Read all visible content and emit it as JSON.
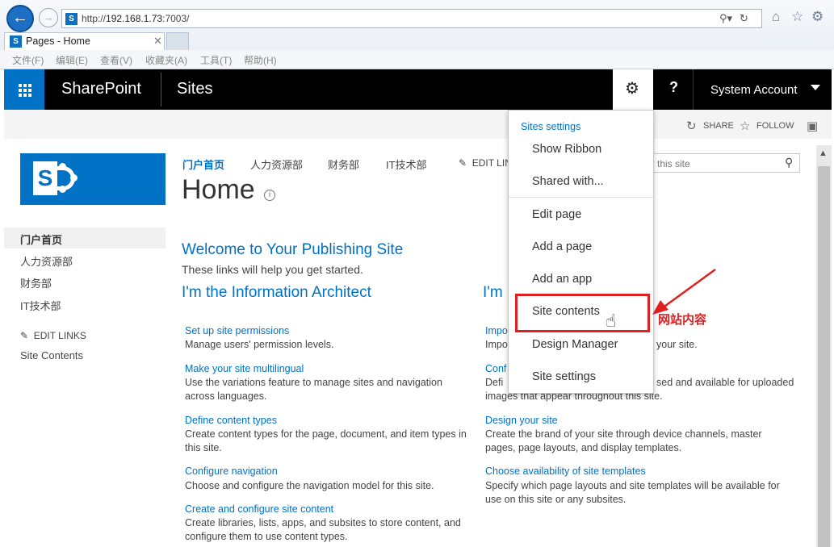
{
  "browser": {
    "address_url": "http://",
    "address_host": "192.168.1.73",
    "address_port": ":7003/",
    "tab_title": "Pages - Home",
    "menus": [
      "文件(F)",
      "编辑(E)",
      "查看(V)",
      "收藏夹(A)",
      "工具(T)",
      "帮助(H)"
    ]
  },
  "suite": {
    "brand": "SharePoint",
    "sites": "Sites",
    "help": "?",
    "account": "System Account",
    "accent": "#0072c6"
  },
  "ribbon": {
    "share": "SHARE",
    "follow": "FOLLOW"
  },
  "topnav": {
    "items": [
      "门户首页",
      "人力资源部",
      "财务部",
      "IT技术部"
    ],
    "edit_links": "EDIT LINKS"
  },
  "search": {
    "placeholder": "this site"
  },
  "page": {
    "title": "Home",
    "info_icon": "i"
  },
  "quicklaunch": {
    "items": [
      "门户首页",
      "人力资源部",
      "财务部",
      "IT技术部"
    ],
    "edit_links": "EDIT LINKS",
    "site_contents": "Site Contents"
  },
  "welcome": {
    "heading": "Welcome to Your Publishing Site",
    "subheading": "These links will help you get started.",
    "left_heading": "I'm the Information Architect",
    "right_heading_partial": "I'm"
  },
  "left_tasks": [
    {
      "link": "Set up site permissions",
      "desc": "Manage users' permission levels."
    },
    {
      "link": "Make your site multilingual",
      "desc": "Use the variations feature to manage sites and navigation across languages."
    },
    {
      "link": "Define content types",
      "desc": "Create content types for the page, document, and item types in this site."
    },
    {
      "link": "Configure navigation",
      "desc": "Choose and configure the navigation model for this site."
    },
    {
      "link": "Create and configure site content",
      "desc": "Create libraries, lists, apps, and subsites to store content, and configure them to use content types."
    }
  ],
  "right_tasks": [
    {
      "link": "Impo",
      "desc": "Impo"
    },
    {
      "link": "Conf",
      "desc": "Defi"
    },
    {
      "link": "Design your site",
      "desc": "Create the brand of your site through device channels, master pages, page layouts, and display templates."
    },
    {
      "link": "Choose availability of site templates",
      "desc": "Specify which page layouts and site templates will be available for use on this site or any subsites."
    }
  ],
  "right_partials": {
    "desc1_tail": "your site.",
    "desc2_tail": "sed and available for uploaded",
    "desc2_line2": "images that appear throughout this site."
  },
  "settings_menu": {
    "heading": "Sites settings",
    "items": [
      "Show Ribbon",
      "Shared with...",
      "Edit page",
      "Add a page",
      "Add an app",
      "Site contents",
      "Design Manager",
      "Site settings"
    ],
    "highlighted": "Site contents"
  },
  "annotation": {
    "label": "网站内容",
    "color": "#e02020"
  }
}
